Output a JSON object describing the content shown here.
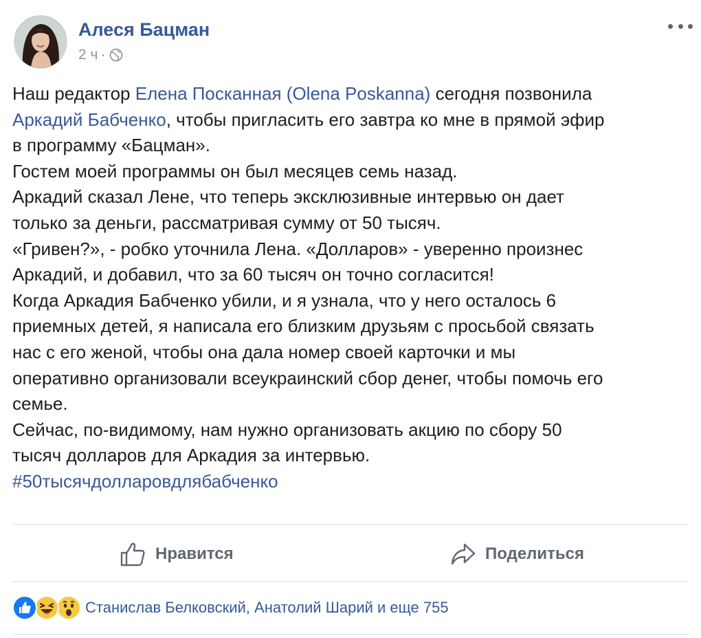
{
  "post": {
    "author": "Алеся Бацман",
    "time": "2 ч",
    "separator": "·",
    "lines": [
      [
        {
          "t": "Наш редактор "
        },
        {
          "t": "Елена Посканная (Olena Poskanna)",
          "link": true
        },
        {
          "t": " сегодня позвонила"
        }
      ],
      [
        {
          "t": "Аркадий Бабченко",
          "link": true
        },
        {
          "t": ", чтобы пригласить его завтра ко мне в прямой эфир"
        }
      ],
      [
        {
          "t": "в программу «Бацман»."
        }
      ],
      [
        {
          "t": "Гостем моей программы он был месяцев семь назад."
        }
      ],
      [
        {
          "t": "Аркадий сказал Лене, что теперь эксклюзивные интервью он дает"
        }
      ],
      [
        {
          "t": "только за деньги, рассматривая сумму от 50 тысяч."
        }
      ],
      [
        {
          "t": "«Гривен?», - робко уточнила Лена. «Долларов» - уверенно произнес"
        }
      ],
      [
        {
          "t": "Аркадий, и добавил, что за 60 тысяч он точно согласится!"
        }
      ],
      [
        {
          "t": "Когда Аркадия Бабченко убили, и я узнала, что у него осталось 6"
        }
      ],
      [
        {
          "t": "приемных детей, я написала его близким друзьям с просьбой связать"
        }
      ],
      [
        {
          "t": "нас с его женой, чтобы она дала номер своей карточки и мы"
        }
      ],
      [
        {
          "t": "оперативно организовали всеукраинский сбор денег, чтобы помочь его"
        }
      ],
      [
        {
          "t": "семье."
        }
      ],
      [
        {
          "t": "Сейчас, по-видимому, нам нужно организовать акцию по сбору 50"
        }
      ],
      [
        {
          "t": "тысяч долларов для Аркадия за интервью."
        }
      ],
      [
        {
          "t": "#50тысячдолларовдлябабченко",
          "link": true
        }
      ]
    ]
  },
  "actions": {
    "like_label": "Нравится",
    "share_label": "Поделиться"
  },
  "reactions": {
    "types": [
      "like-icon",
      "haha-icon",
      "wow-icon"
    ],
    "summary": "Станислав Белковский, Анатолий Шарий и еще 755"
  },
  "colors": {
    "link": "#385898",
    "text": "#1c1e21",
    "muted": "#90949c",
    "like_blue": "#1877f2",
    "emoji_yellow": "#f7c844"
  }
}
